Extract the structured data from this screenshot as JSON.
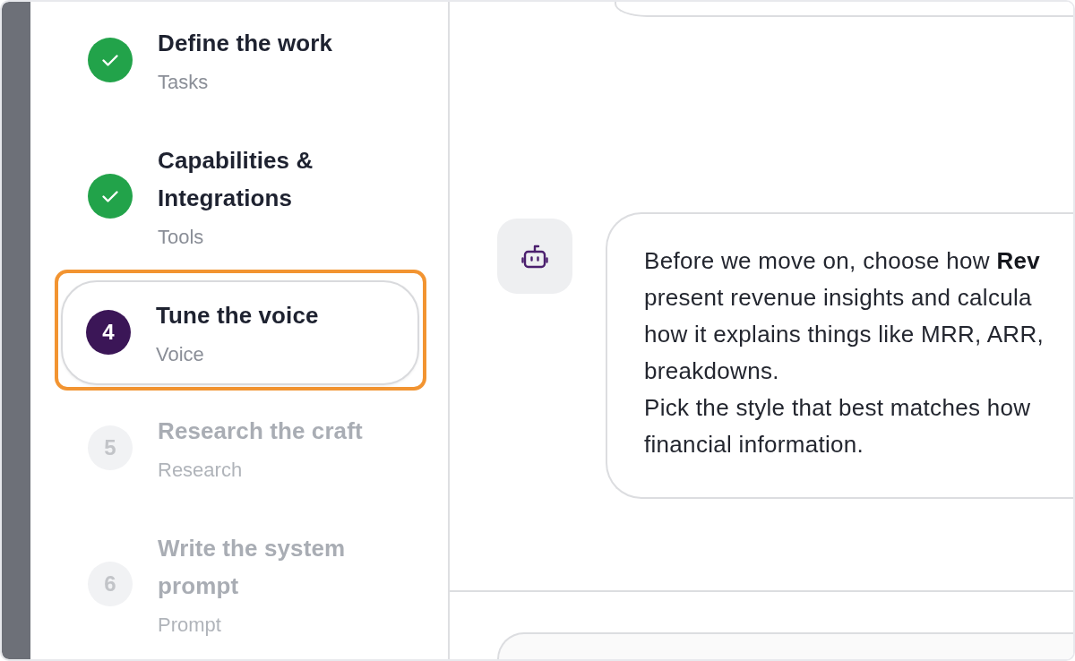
{
  "steps": [
    {
      "title": "Define the work",
      "subtitle": "Tasks",
      "completed": true,
      "selected": false,
      "disabled": false,
      "highlighted": false
    },
    {
      "title": "Capabilities & Integrations",
      "subtitle": "Tools",
      "completed": true,
      "selected": false,
      "disabled": false,
      "highlighted": false
    },
    {
      "number": "4",
      "title": "Tune the voice",
      "subtitle": "Voice",
      "completed": false,
      "selected": true,
      "disabled": false,
      "highlighted": true
    },
    {
      "number": "5",
      "title": "Research the craft",
      "subtitle": "Research",
      "completed": false,
      "selected": false,
      "disabled": true,
      "highlighted": false
    },
    {
      "number": "6",
      "title": "Write the system prompt",
      "subtitle": "Prompt",
      "completed": false,
      "selected": false,
      "disabled": true,
      "highlighted": false
    }
  ],
  "chat": {
    "messages": [
      {
        "kind": "cut_bubble"
      },
      {
        "kind": "bot",
        "lines": [
          "Before we move on, choose how **Rev**",
          "present revenue insights and calcula",
          "how it explains things like MRR, ARR,",
          "breakdowns.",
          "Pick the style that best matches how",
          "financial information."
        ]
      }
    ]
  }
}
